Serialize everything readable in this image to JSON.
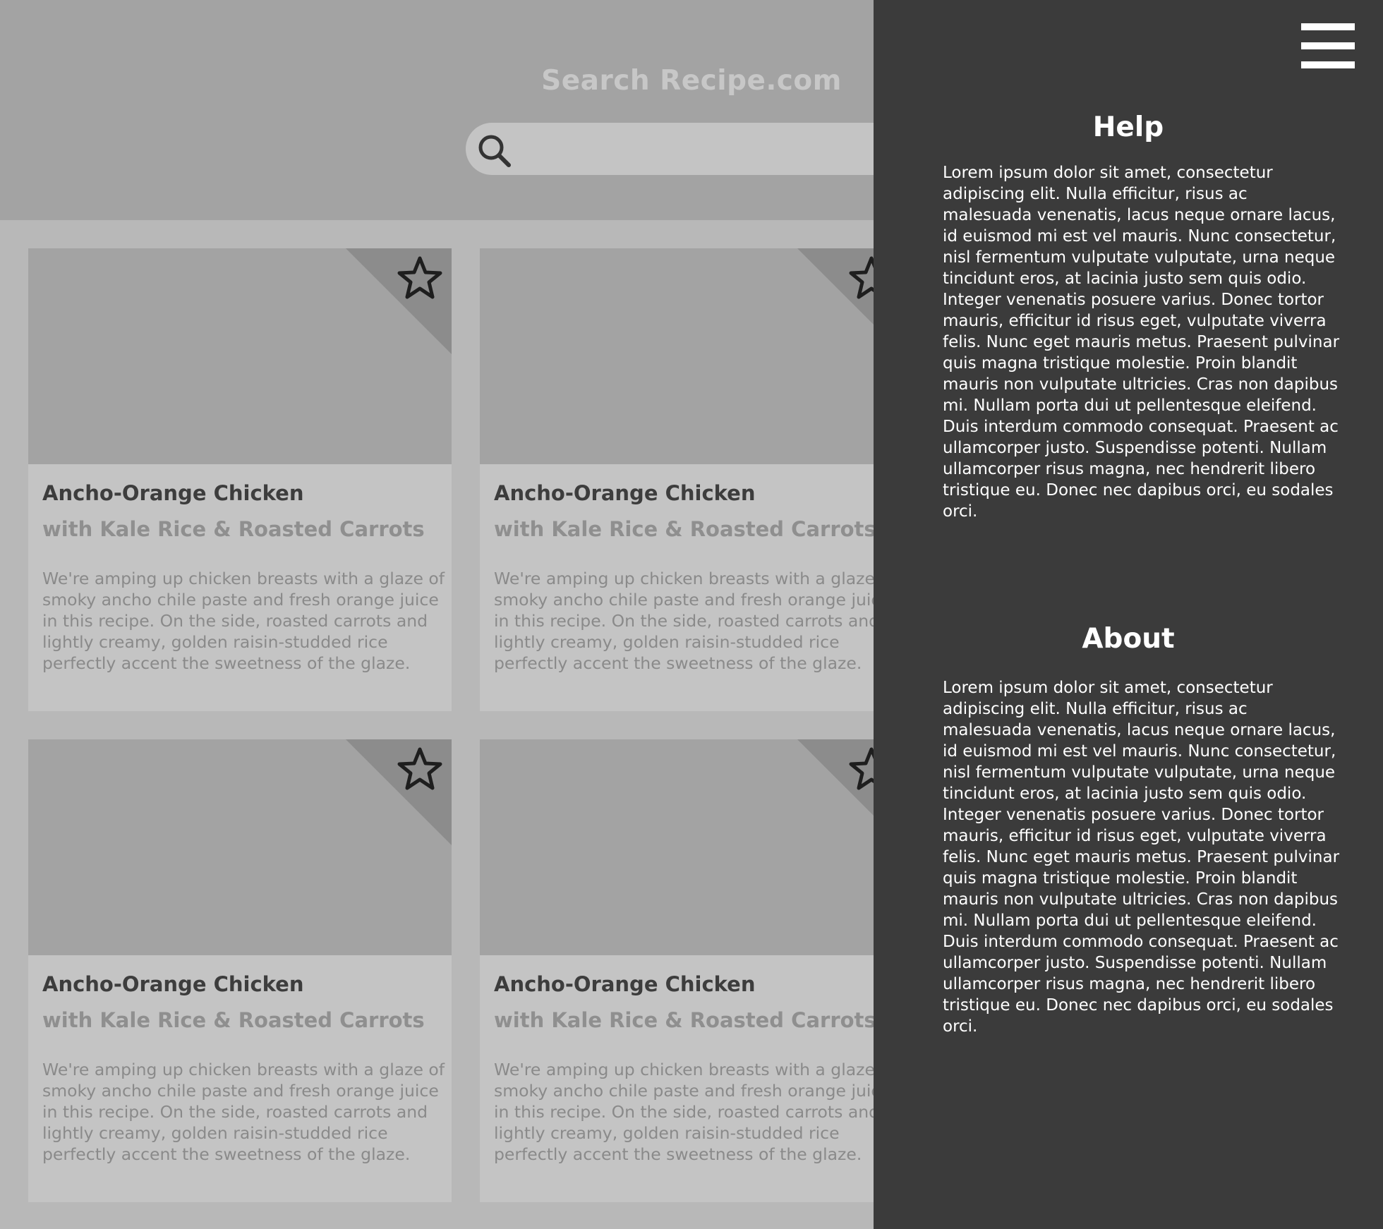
{
  "header": {
    "site_title": "Search Recipe.com",
    "search_placeholder": ""
  },
  "cards": [
    {
      "title": "Ancho-Orange Chicken",
      "subtitle": "with Kale Rice & Roasted Carrots",
      "description": "We're amping up chicken breasts with a glaze of smoky ancho chile paste and fresh orange juice in this recipe. On the side, roasted carrots and lightly creamy, golden raisin-studded rice perfectly accent the sweetness of the glaze."
    },
    {
      "title": "Ancho-Orange Chicken",
      "subtitle": "with Kale Rice & Roasted Carrots",
      "description": "We're amping up chicken breasts with a glaze of smoky ancho chile paste and fresh orange juice in this recipe. On the side, roasted carrots and lightly creamy, golden raisin-studded rice perfectly accent the sweetness of the glaze."
    },
    {
      "title": "Ancho-Orange Chicken",
      "subtitle": "with Kale Rice & Roasted Carrots",
      "description": "We're amping up chicken breasts with a glaze of smoky ancho chile paste and fresh orange juice in this recipe. On the side, roasted carrots and lightly creamy, golden raisin-studded rice perfectly accent the sweetness of the glaze."
    },
    {
      "title": "Ancho-Orange Chicken",
      "subtitle": "with Kale Rice & Roasted Carrots",
      "description": "We're amping up chicken breasts with a glaze of smoky ancho chile paste and fresh orange juice in this recipe. On the side, roasted carrots and lightly creamy, golden raisin-studded rice perfectly accent the sweetness of the glaze."
    }
  ],
  "drawer": {
    "help_heading": "Help",
    "help_text": "Lorem ipsum dolor sit amet, consectetur adipiscing elit. Nulla efficitur, risus ac malesuada venenatis, lacus neque ornare lacus, id euismod mi est vel mauris. Nunc consectetur, nisl fermentum vulputate vulputate, urna neque tincidunt eros, at lacinia justo sem quis odio. Integer venenatis posuere varius. Donec tortor mauris, efficitur id risus eget, vulputate viverra felis. Nunc eget mauris metus. Praesent pulvinar quis magna tristique molestie. Proin blandit mauris non vulputate ultricies. Cras non dapibus mi. Nullam porta dui ut pellentesque eleifend. Duis interdum commodo consequat. Praesent ac ullamcorper justo. Suspendisse potenti. Nullam ullamcorper risus magna, nec hendrerit libero tristique eu. Donec nec dapibus orci, eu sodales orci.",
    "about_heading": "About",
    "about_text": "Lorem ipsum dolor sit amet, consectetur adipiscing elit. Nulla efficitur, risus ac malesuada venenatis, lacus neque ornare lacus, id euismod mi est vel mauris. Nunc consectetur, nisl fermentum vulputate vulputate, urna neque tincidunt eros, at lacinia justo sem quis odio. Integer venenatis posuere varius. Donec tortor mauris, efficitur id risus eget, vulputate viverra felis. Nunc eget mauris metus. Praesent pulvinar quis magna tristique molestie. Proin blandit mauris non vulputate ultricies. Cras non dapibus mi. Nullam porta dui ut pellentesque eleifend. Duis interdum commodo consequat. Praesent ac ullamcorper justo. Suspendisse potenti. Nullam ullamcorper risus magna, nec hendrerit libero tristique eu. Donec nec dapibus orci, eu sodales orci."
  },
  "icons": {
    "search": "search-icon",
    "favorite": "star-outline-icon",
    "menu": "hamburger-menu-icon"
  },
  "colors": {
    "page_background": "#b8b8b8",
    "header_background": "#a3a3a3",
    "card_background": "#c4c4c4",
    "drawer_background": "#3b3b3b",
    "drawer_text": "#ffffff"
  }
}
